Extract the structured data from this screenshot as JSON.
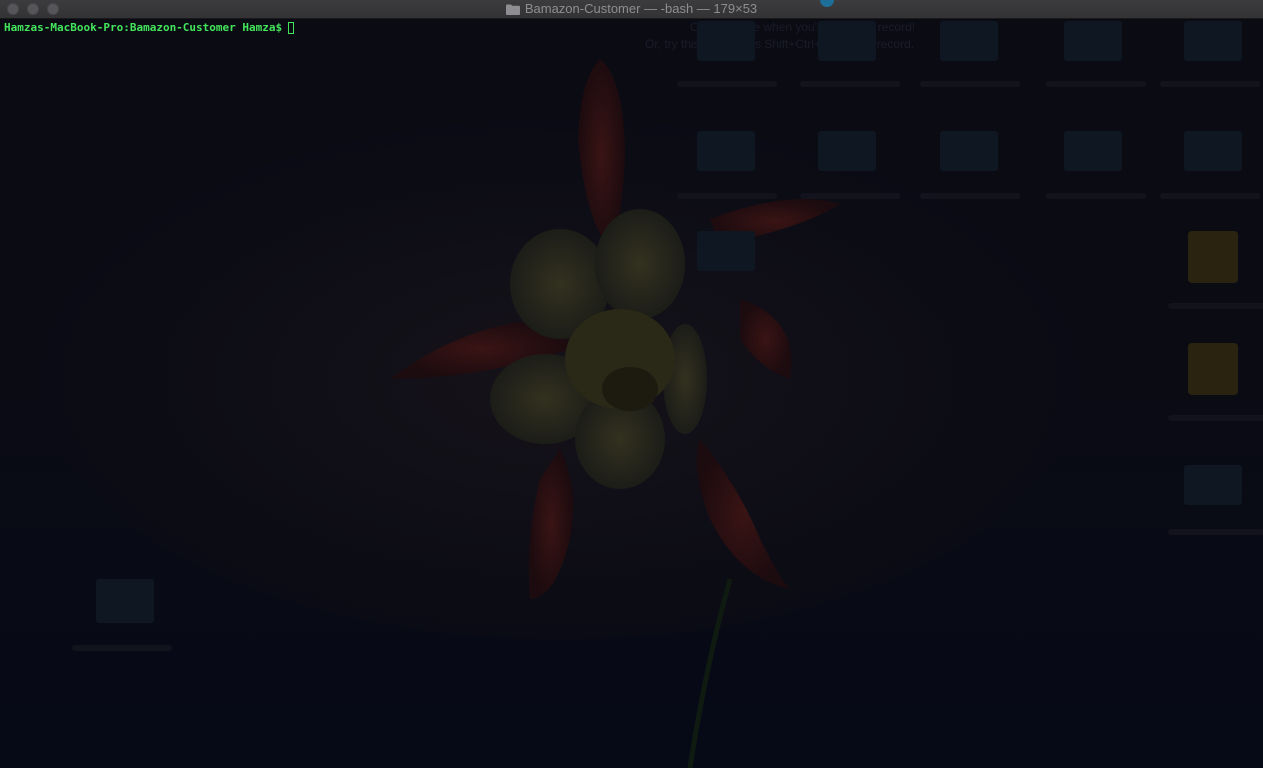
{
  "window": {
    "title": "Bamazon-Customer — -bash — 179×53",
    "icons": {
      "close": "close-button",
      "minimize": "minimize-button",
      "maximize": "maximize-button",
      "title_icon": "folder-icon"
    }
  },
  "terminal": {
    "prompt": "Hamzas-MacBook-Pro:Bamazon-Customer Hamza$",
    "input": "",
    "prompt_color": "#43e55b"
  },
  "background": {
    "recorder_hint_line1": "Click up here when you're ready to record!",
    "recorder_hint_line2": "Or, try this trick: press Shift+Ctrl+Cmd+5 to record."
  }
}
